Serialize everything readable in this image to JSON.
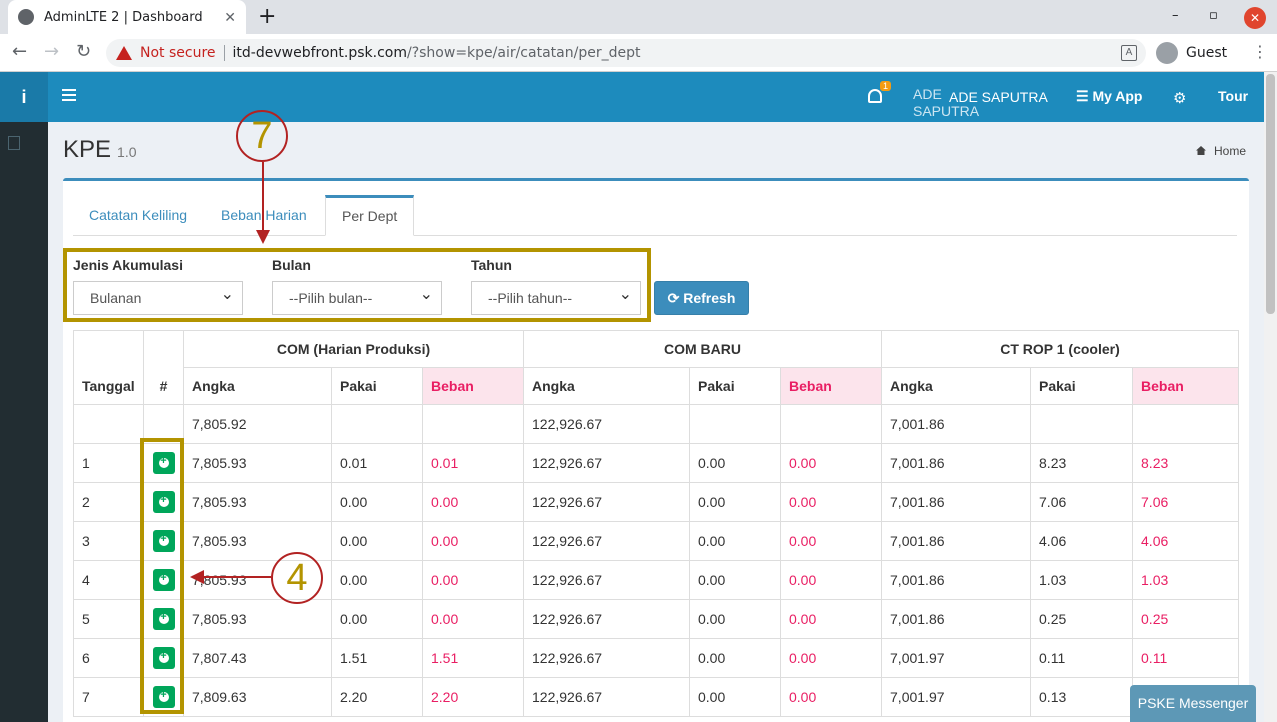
{
  "browser": {
    "tab_title": "AdminLTE 2 | Dashboard",
    "tab_close": "✕",
    "new_tab": "+",
    "not_secure": "Not secure",
    "url_host": "itd-devwebfront.psk.com",
    "url_path": "/?show=kpe/air/catatan/per_dept",
    "profile": "Guest",
    "controls": {
      "minimize": "–",
      "maximize": "▫",
      "close": "✕"
    }
  },
  "header": {
    "logo": "i",
    "notification_count": "1",
    "user_image_alt": "ADE SAPUTRA",
    "user_name": "ADE SAPUTRA",
    "my_app": "My App",
    "tour": "Tour"
  },
  "page": {
    "title": "KPE",
    "version": "1.0",
    "breadcrumb": "Home"
  },
  "tabs": [
    "Catatan Keliling",
    "Beban Harian",
    "Per Dept"
  ],
  "filters": {
    "jenis_label": "Jenis Akumulasi",
    "jenis_value": "Bulanan",
    "bulan_label": "Bulan",
    "bulan_value": "--Pilih bulan--",
    "tahun_label": "Tahun",
    "tahun_value": "--Pilih tahun--",
    "refresh": "Refresh"
  },
  "table": {
    "col_tanggal": "Tanggal",
    "col_hash": "#",
    "groups": [
      "COM (Harian Produksi)",
      "COM BARU",
      "CT ROP 1 (cooler)"
    ],
    "sub": {
      "angka": "Angka",
      "pakai": "Pakai",
      "beban": "Beban"
    },
    "initial": [
      "7,805.92",
      "122,926.67",
      "7,001.86"
    ],
    "rows": [
      {
        "tanggal": "1",
        "c1": [
          "7,805.93",
          "0.01",
          "0.01"
        ],
        "c2": [
          "122,926.67",
          "0.00",
          "0.00"
        ],
        "c3": [
          "7,001.86",
          "8.23",
          "8.23"
        ]
      },
      {
        "tanggal": "2",
        "c1": [
          "7,805.93",
          "0.00",
          "0.00"
        ],
        "c2": [
          "122,926.67",
          "0.00",
          "0.00"
        ],
        "c3": [
          "7,001.86",
          "7.06",
          "7.06"
        ]
      },
      {
        "tanggal": "3",
        "c1": [
          "7,805.93",
          "0.00",
          "0.00"
        ],
        "c2": [
          "122,926.67",
          "0.00",
          "0.00"
        ],
        "c3": [
          "7,001.86",
          "4.06",
          "4.06"
        ]
      },
      {
        "tanggal": "4",
        "c1": [
          "7,805.93",
          "0.00",
          "0.00"
        ],
        "c2": [
          "122,926.67",
          "0.00",
          "0.00"
        ],
        "c3": [
          "7,001.86",
          "1.03",
          "1.03"
        ]
      },
      {
        "tanggal": "5",
        "c1": [
          "7,805.93",
          "0.00",
          "0.00"
        ],
        "c2": [
          "122,926.67",
          "0.00",
          "0.00"
        ],
        "c3": [
          "7,001.86",
          "0.25",
          "0.25"
        ]
      },
      {
        "tanggal": "6",
        "c1": [
          "7,807.43",
          "1.51",
          "1.51"
        ],
        "c2": [
          "122,926.67",
          "0.00",
          "0.00"
        ],
        "c3": [
          "7,001.97",
          "0.11",
          "0.11"
        ]
      },
      {
        "tanggal": "7",
        "c1": [
          "7,809.63",
          "2.20",
          "2.20"
        ],
        "c2": [
          "122,926.67",
          "0.00",
          "0.00"
        ],
        "c3": [
          "7,001.97",
          "0.13",
          ""
        ]
      }
    ]
  },
  "annotations": {
    "seven": "7",
    "four": "4"
  },
  "messenger": "PSKE Messenger",
  "colors": {
    "accent": "#3c8dbc",
    "header": "#1d8bbd",
    "sidebar": "#222d32",
    "beban": "#e91e63",
    "add": "#00a65a",
    "highlight": "#b39400",
    "annotation": "#b22222"
  }
}
